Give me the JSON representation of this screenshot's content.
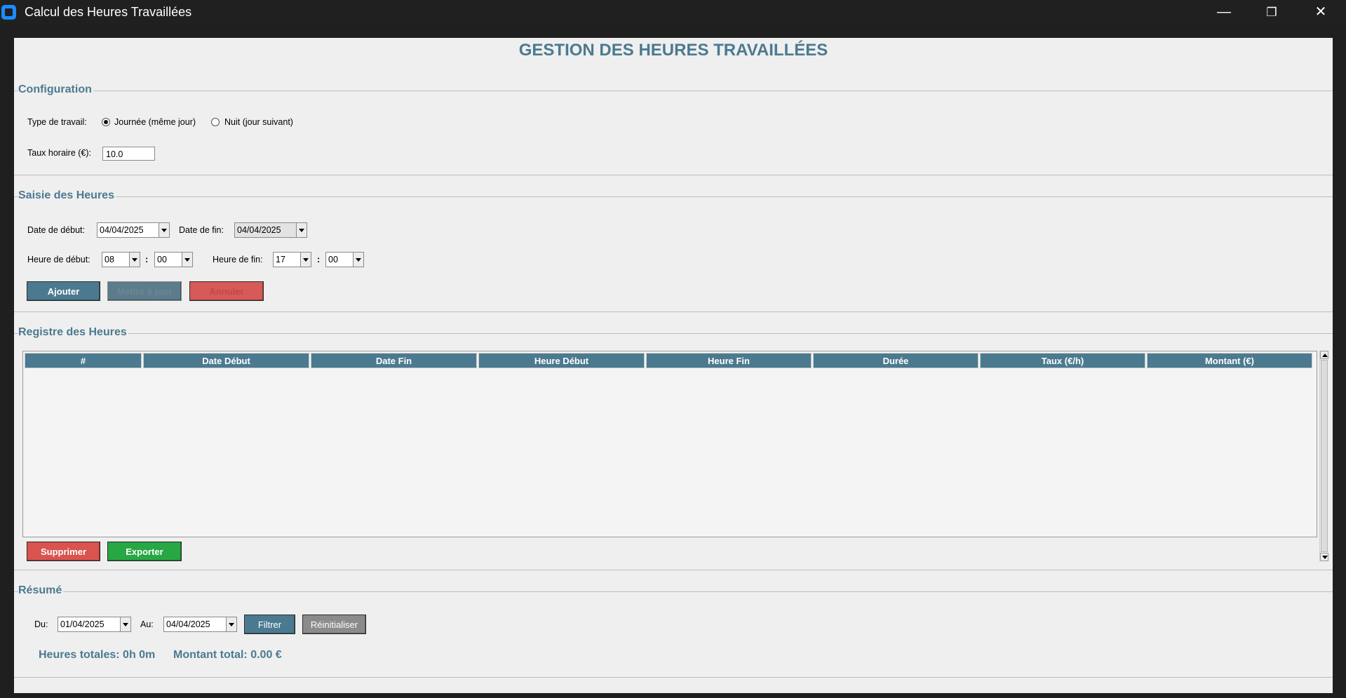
{
  "window": {
    "title": "Calcul des Heures Travaillées",
    "minimize_glyph": "—",
    "restore_glyph": "❐",
    "close_glyph": "✕"
  },
  "header": {
    "title": "GESTION DES HEURES TRAVAILLÉES"
  },
  "configuration": {
    "title": "Configuration",
    "work_type_label": "Type de travail:",
    "radio_day_label": "Journée (même jour)",
    "radio_night_label": "Nuit (jour suivant)",
    "selected_work_type": "day",
    "rate_label": "Taux horaire (€):",
    "rate_value": "10.0"
  },
  "entry": {
    "title": "Saisie des Heures",
    "start_date_label": "Date de début:",
    "start_date": "04/04/2025",
    "end_date_label": "Date de fin:",
    "end_date": "04/04/2025",
    "start_time_label": "Heure de début:",
    "start_hour": "08",
    "start_minute": "00",
    "end_time_label": "Heure de fin:",
    "end_hour": "17",
    "end_minute": "00",
    "time_separator": ":",
    "add_button": "Ajouter",
    "update_button": "Mettre à jour",
    "cancel_button": "Annuler"
  },
  "register": {
    "title": "Registre des Heures",
    "columns": [
      "#",
      "Date Début",
      "Date Fin",
      "Heure Début",
      "Heure Fin",
      "Durée",
      "Taux (€/h)",
      "Montant (€)"
    ],
    "rows": [],
    "delete_button": "Supprimer",
    "export_button": "Exporter"
  },
  "summary": {
    "title": "Résumé",
    "from_label": "Du:",
    "from_date": "01/04/2025",
    "to_label": "Au:",
    "to_date": "04/04/2025",
    "filter_button": "Filtrer",
    "reset_button": "Réinitialiser",
    "total_hours": "Heures totales: 0h 0m",
    "total_amount": "Montant total: 0.00 €"
  },
  "colors": {
    "accent": "#4b7a90",
    "danger": "#d9534f",
    "success": "#28a745",
    "neutral": "#8b8b8b"
  }
}
